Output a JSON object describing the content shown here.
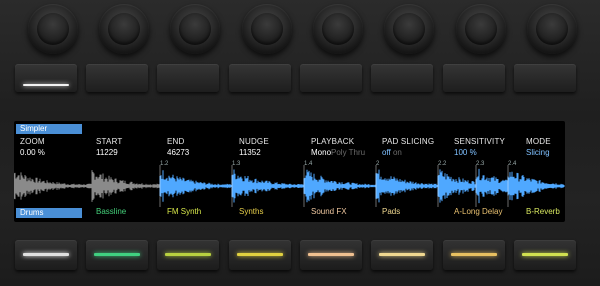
{
  "panel": {
    "top_tab": "Simpler",
    "bottom_tab": "Drums"
  },
  "params": [
    {
      "label": "ZOOM",
      "value": "0.00 %"
    },
    {
      "label": "START",
      "value": "11229"
    },
    {
      "label": "END",
      "value": "46273"
    },
    {
      "label": "NUDGE",
      "value": "11352"
    },
    {
      "label": "PLAYBACK",
      "value": "Mono",
      "options_dim": "Poly Thru"
    },
    {
      "label": "PAD SLICING",
      "value": "off",
      "options_dim": "on"
    },
    {
      "label": "SENSITIVITY",
      "value": "100 %"
    },
    {
      "label": "MODE",
      "value": "Slicing"
    }
  ],
  "tracks": [
    {
      "name": "Drums",
      "color": "#d8d8d8"
    },
    {
      "name": "Bassline",
      "color": "#44d07a"
    },
    {
      "name": "FM Synth",
      "color": "#d8e84a"
    },
    {
      "name": "Synths",
      "color": "#e8d04a"
    },
    {
      "name": "Sound FX",
      "color": "#f0c8a0"
    },
    {
      "name": "Pads",
      "color": "#f0d890"
    },
    {
      "name": "A-Long Delay",
      "color": "#e8c070"
    },
    {
      "name": "B-Reverb",
      "color": "#d8e860"
    }
  ],
  "slice_markers": [
    "1.2",
    "1.3",
    "1.4",
    "2",
    "2.2",
    "2.3",
    "2.4"
  ],
  "colors": {
    "accent": "#4a8fd6",
    "waveform_active": "#4fa8ff",
    "waveform_inactive": "#8a8a8a"
  }
}
